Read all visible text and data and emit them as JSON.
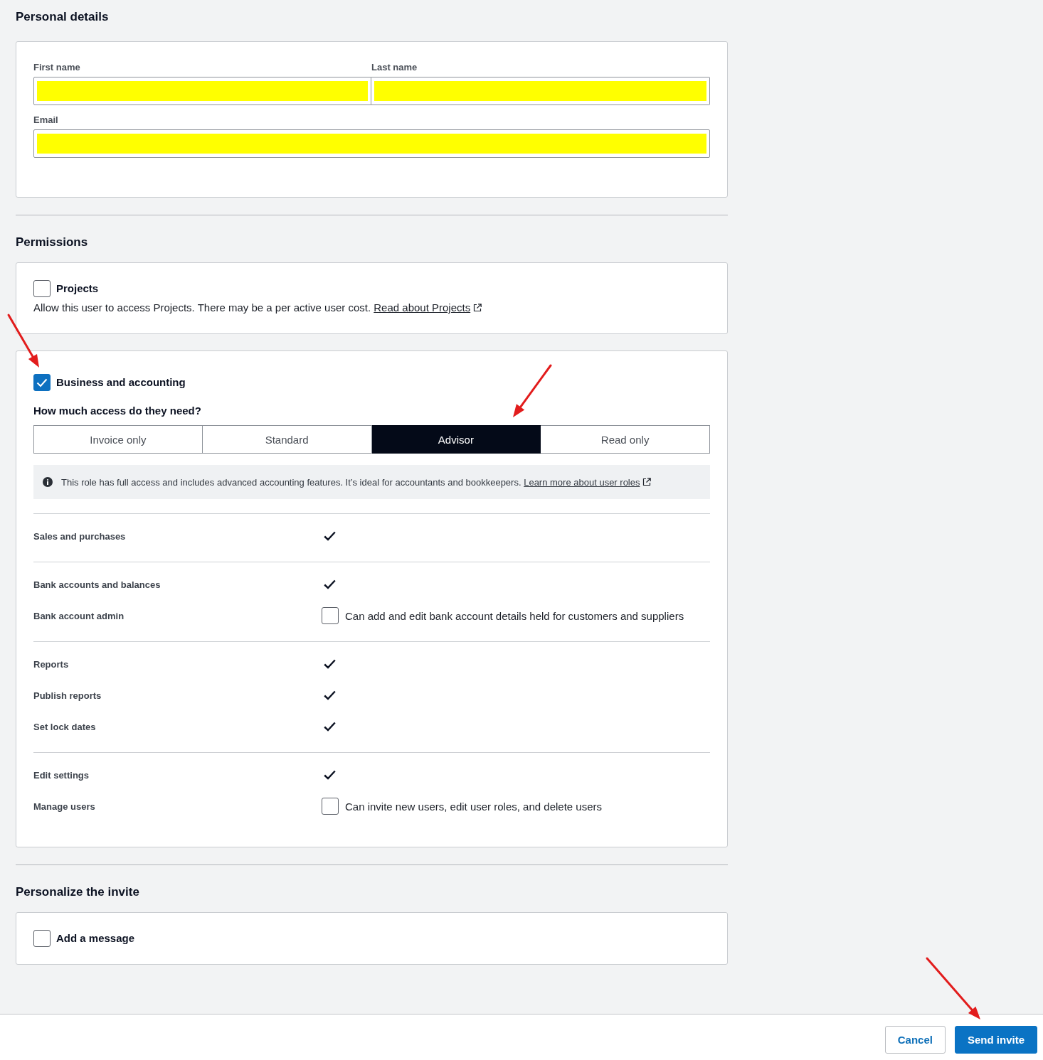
{
  "personal_details": {
    "title": "Personal details",
    "name_fields": [
      {
        "label": "First name",
        "redacted": true
      },
      {
        "label": "Last name",
        "redacted": true
      }
    ],
    "email_field": {
      "label": "Email",
      "redacted": true
    }
  },
  "permissions": {
    "title": "Permissions",
    "projects": {
      "label": "Projects",
      "checked": false,
      "description": "Allow this user to access Projects. There may be a per active user cost.",
      "link": "Read about Projects"
    },
    "business": {
      "label": "Business and accounting",
      "checked": true,
      "pointed_at": true,
      "question": "How much access do they need?",
      "roles": [
        {
          "label": "Invoice only",
          "selected": false,
          "pointed_at": false
        },
        {
          "label": "Standard",
          "selected": false,
          "pointed_at": false
        },
        {
          "label": "Advisor",
          "selected": true,
          "pointed_at": true
        },
        {
          "label": "Read only",
          "selected": false,
          "pointed_at": false
        }
      ],
      "info": {
        "text": "This role has full access and includes advanced accounting features. It’s ideal for accountants and bookkeepers.",
        "link": "Learn more about user roles"
      },
      "groups": [
        {
          "rows": [
            {
              "kind": "included",
              "label": "Sales and purchases"
            }
          ]
        },
        {
          "rows": [
            {
              "kind": "included",
              "label": "Bank accounts and balances"
            },
            {
              "kind": "option",
              "label": "Bank account admin",
              "checked": false,
              "description": "Can add and edit bank account details held for customers and suppliers"
            }
          ]
        },
        {
          "rows": [
            {
              "kind": "included",
              "label": "Reports"
            },
            {
              "kind": "included",
              "label": "Publish reports"
            },
            {
              "kind": "included",
              "label": "Set lock dates"
            }
          ]
        },
        {
          "rows": [
            {
              "kind": "included",
              "label": "Edit settings"
            },
            {
              "kind": "option",
              "label": "Manage users",
              "checked": false,
              "description": "Can invite new users, edit user roles, and delete users"
            }
          ]
        }
      ]
    }
  },
  "personalize": {
    "title": "Personalize the invite",
    "message": {
      "label": "Add a message",
      "checked": false
    }
  },
  "footer": {
    "buttons": [
      {
        "kind": "secondary",
        "label": "Cancel",
        "pointed_at": false
      },
      {
        "kind": "primary",
        "label": "Send invite",
        "pointed_at": true
      }
    ]
  }
}
